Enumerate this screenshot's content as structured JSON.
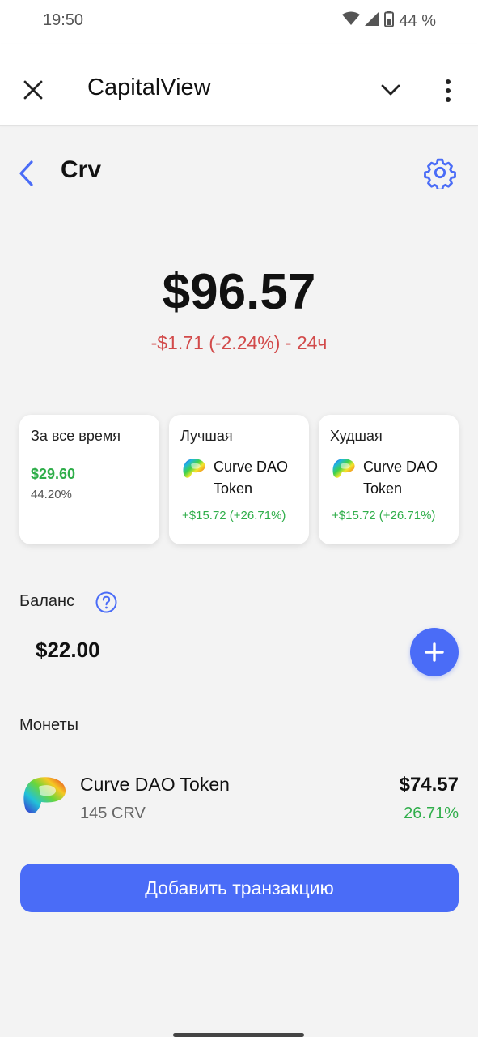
{
  "status_bar": {
    "time": "19:50",
    "battery": "44 %",
    "icons": [
      "wifi-icon",
      "signal-icon",
      "battery-icon"
    ]
  },
  "app_bar": {
    "title": "CapitalView",
    "icons": [
      "close-icon",
      "chevron-down-icon",
      "more-vertical-icon"
    ]
  },
  "header": {
    "title": "Crv",
    "icons": [
      "back-icon",
      "gear-icon"
    ]
  },
  "price": {
    "value": "$96.57",
    "change": "-$1.71 (-2.24%) - 24ч"
  },
  "cards": {
    "all_time": {
      "title": "За все время",
      "value": "$29.60",
      "percent": "44.20%"
    },
    "best": {
      "title": "Лучшая",
      "coin_line1": "Curve DAO",
      "coin_line2": "Token",
      "gain": "+$15.72 (+26.71%)"
    },
    "worst": {
      "title": "Худшая",
      "coin_line1": "Curve DAO",
      "coin_line2": "Token",
      "gain": "+$15.72 (+26.71%)"
    }
  },
  "balance": {
    "label": "Баланс",
    "value": "$22.00"
  },
  "coins": {
    "label": "Монеты",
    "items": [
      {
        "name": "Curve DAO Token",
        "amount": "145 CRV",
        "value": "$74.57",
        "percent": "26.71%"
      }
    ]
  },
  "actions": {
    "add_transaction": "Добавить транзакцию"
  },
  "colors": {
    "accent": "#4a6cf7",
    "positive": "#2fae4a",
    "negative": "#d24a4a",
    "background": "#f3f3f3"
  }
}
